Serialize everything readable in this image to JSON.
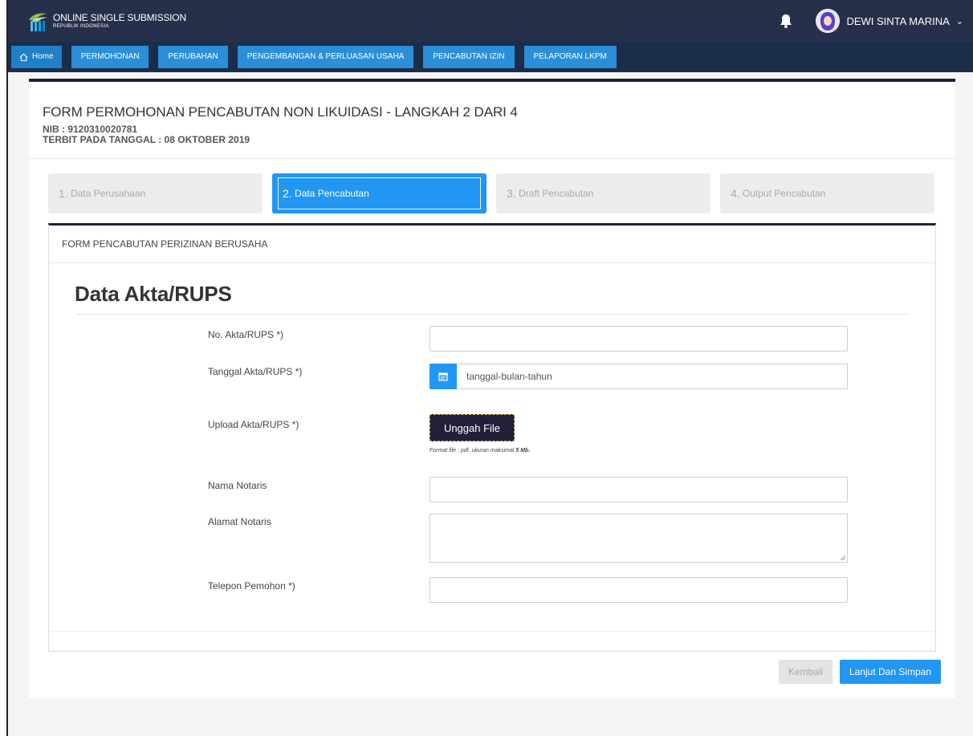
{
  "header": {
    "logo_title": "ONLINE SINGLE SUBMISSION",
    "logo_subtitle": "REPUBLIK INDONESIA",
    "user_name": "DEWI SINTA MARINA",
    "brand_color": "#27304a"
  },
  "nav": {
    "items": [
      {
        "label": "Home",
        "icon": "home-icon"
      },
      {
        "label": "PERMOHONAN"
      },
      {
        "label": "PERUBAHAN"
      },
      {
        "label": "PENGEMBANGAN & PERLUASAN USAHA"
      },
      {
        "label": "PENCABUTAN IZIN"
      },
      {
        "label": "PELAPORAN LKPM"
      }
    ],
    "accent_color": "#2196f3"
  },
  "page": {
    "title": "FORM PERMOHONAN PENCABUTAN NON LIKUIDASI - LANGKAH 2 DARI 4",
    "nib": "NIB : 9120310020781",
    "issued": "TERBIT PADA TANGGAL : 08 OKTOBER 2019"
  },
  "steps": [
    {
      "num": "1.",
      "label": "Data Perusahaan",
      "active": false
    },
    {
      "num": "2.",
      "label": "Data Pencabutan",
      "active": true
    },
    {
      "num": "3.",
      "label": "Draft Pencabutan",
      "active": false
    },
    {
      "num": "4.",
      "label": "Output Pencabutan",
      "active": false
    }
  ],
  "form": {
    "panel_title": "FORM PENCABUTAN PERIZINAN BERUSAHA",
    "section_title": "Data Akta/RUPS",
    "fields": {
      "no_akta_label": "No. Akta/RUPS *)",
      "no_akta_value": "",
      "tanggal_label": "Tanggal Akta/RUPS *)",
      "tanggal_placeholder": "tanggal-bulan-tahun",
      "upload_label": "Upload Akta/RUPS *)",
      "upload_button": "Unggah File",
      "upload_hint": "Format file : pdf, ukuran maksimal",
      "upload_hint_size": "5 Mb.",
      "notaris_label": "Nama Notaris",
      "notaris_value": "",
      "alamat_label": "Alamat Notaris",
      "alamat_value": "",
      "telepon_label": "Telepon Pemohon *)",
      "telepon_value": ""
    }
  },
  "actions": {
    "back_label": "Kembali",
    "next_label": "Lanjut Dan Simpan"
  }
}
